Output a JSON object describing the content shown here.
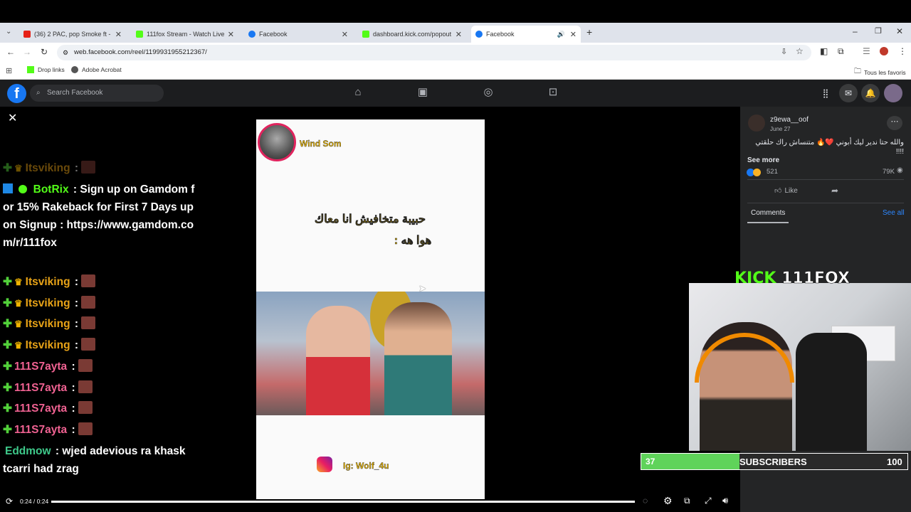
{
  "tabs": [
    {
      "title": "(36) 2 PAC, pop Smoke ft - Bigg",
      "fav_color": "#e62117"
    },
    {
      "title": "111fox Stream - Watch Live on",
      "fav_color": "#53fc18"
    },
    {
      "title": "Facebook",
      "fav_color": "#1877f2"
    },
    {
      "title": "dashboard.kick.com/popout/11",
      "fav_color": "#53fc18"
    },
    {
      "title": "Facebook",
      "fav_color": "#1877f2"
    }
  ],
  "address": "web.facebook.com/reel/1199931955212367/",
  "bookmarks": {
    "items": [
      "Drop links",
      "Adobe Acrobat"
    ],
    "all": "Tous les favoris"
  },
  "fb": {
    "search_placeholder": "Search Facebook"
  },
  "chat": [
    {
      "user": "Itsviking",
      "color": "#e8a317",
      "text": ""
    },
    {
      "user": "BotRix",
      "color": "#53fc18",
      "text": "Sign up on Gamdom for 15% Rakeback for First 7 Days upon Signup : https://www.gamdom.com/r/111fox"
    },
    {
      "user": "Itsviking",
      "color": "#e8a317",
      "text": ""
    },
    {
      "user": "Itsviking",
      "color": "#e8a317",
      "text": ""
    },
    {
      "user": "Itsviking",
      "color": "#e8a317",
      "text": ""
    },
    {
      "user": "Itsviking",
      "color": "#e8a317",
      "text": ""
    },
    {
      "user": "111S7ayta",
      "color": "#f06292",
      "text": ""
    },
    {
      "user": "111S7ayta",
      "color": "#f06292",
      "text": ""
    },
    {
      "user": "111S7ayta",
      "color": "#f06292",
      "text": ""
    },
    {
      "user": "111S7ayta",
      "color": "#f06292",
      "text": ""
    },
    {
      "user": "Eddmow",
      "color": "#3ec98a",
      "text": "wjed adevious ra khask tcarri had zrag"
    }
  ],
  "video": {
    "channel": "Wind Som",
    "caption_line1": "حبيبة متخافيش انا معاك",
    "caption_line2": "هوا هه :",
    "ig": "Ig: Wolf_4u",
    "time": "0:24 / 0:24",
    "progress": 1.0
  },
  "post": {
    "author": "z9ewa__oof",
    "date": "June 27",
    "text": "والله حتا ندير ليك أبوني ❤️🔥 متنساش راك حلقتي !!!!",
    "see_more": "See more",
    "reactions": "521",
    "views": "79K",
    "like": "Like",
    "comments": "Comments",
    "see_all": "See all"
  },
  "stream": {
    "kick": "KICK",
    "channel": "111FOX",
    "sub_count": "37",
    "sub_label": "SUBSCRIBERS",
    "sub_goal": "100",
    "sub_progress": 0.37
  }
}
